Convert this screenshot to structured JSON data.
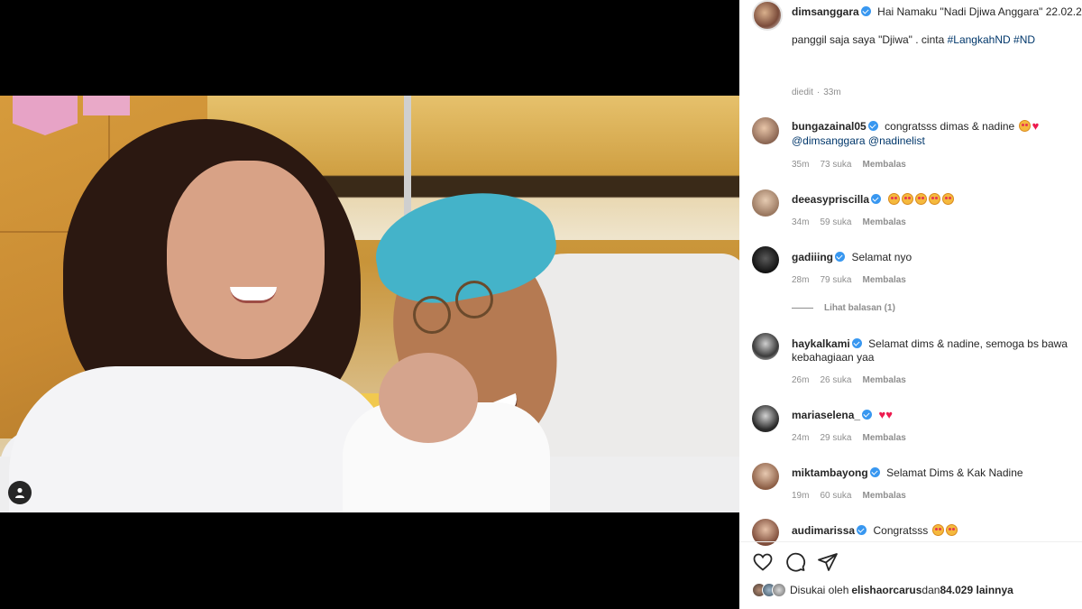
{
  "post": {
    "author": "dimsanggara",
    "caption_line1": "Hai Namaku \"Nadi Djiwa Anggara\" 22.02.2",
    "caption_line2": "panggil saja saya \"Djiwa\" . cinta ",
    "hashtag1": "#LangkahND",
    "hashtag2": "#ND",
    "edited_label": "diedit",
    "edited_time": "33m"
  },
  "comments": [
    {
      "user": "bungazainal05",
      "text": "congratsss dimas & nadine",
      "mention1": "@dimsanggara",
      "mention2": "@nadinelist",
      "time": "35m",
      "likes": "73 suka",
      "reply": "Membalas"
    },
    {
      "user": "deeasypriscilla",
      "time": "34m",
      "likes": "59 suka",
      "reply": "Membalas"
    },
    {
      "user": "gadiiing",
      "text": "Selamat nyo",
      "time": "28m",
      "likes": "79 suka",
      "reply": "Membalas",
      "view_replies": "Lihat balasan (1)"
    },
    {
      "user": "haykalkami",
      "text": "Selamat dims & nadine, semoga bs bawa",
      "text2": "kebahagiaan yaa",
      "time": "26m",
      "likes": "26 suka",
      "reply": "Membalas"
    },
    {
      "user": "mariaselena_",
      "time": "24m",
      "likes": "29 suka",
      "reply": "Membalas"
    },
    {
      "user": "miktambayong",
      "text": "Selamat Dims & Kak Nadine",
      "time": "19m",
      "likes": "60 suka",
      "reply": "Membalas"
    },
    {
      "user": "audimarissa",
      "text": "Congratsss"
    }
  ],
  "likes_summary": {
    "prefix": "Disukai oleh",
    "user": "elishaorcarus",
    "middle": "dan",
    "count": "84.029 lainnya"
  },
  "icons": [
    "heart-icon",
    "comment-icon",
    "share-icon",
    "user-tag-icon",
    "verified-badge-icon"
  ],
  "colors": {
    "verified": "#3897f0",
    "link": "#00376b",
    "meta": "#8e8e8e",
    "heart": "#ed1b4f"
  }
}
